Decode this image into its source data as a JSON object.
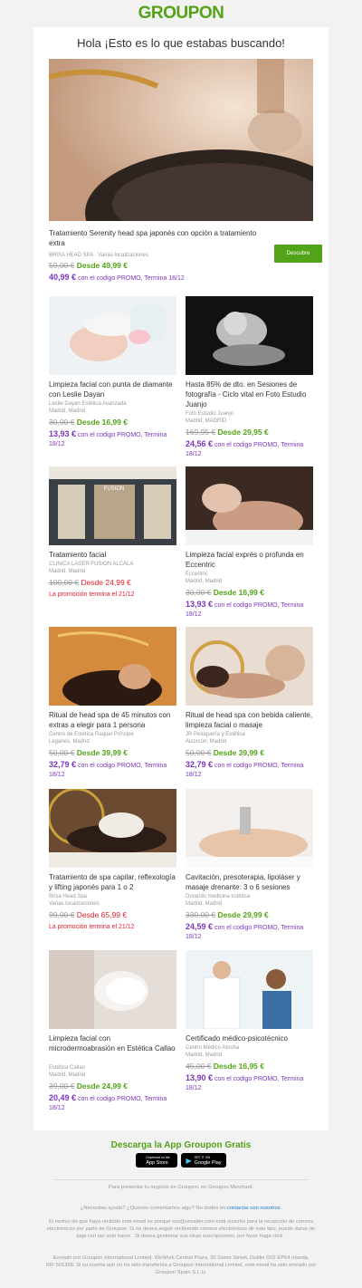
{
  "brand": {
    "logo": "GROUPON",
    "accent": "#53a318",
    "promo_color": "#7b35bf",
    "alert_color": "#e5202e"
  },
  "greeting": "Hola ¡Esto es lo que estabas buscando!",
  "featured": {
    "title": "Tratamiento Serenity head spa japonés con opción a tratamiento extra",
    "merchant": "BRISA HEAD SPA",
    "location": "Varias localizaciones",
    "old_price": "59,00 €",
    "new_price": "Desde 49,99 €",
    "promo_price": "40,99 €",
    "promo_text": "con el codigo PROMO, Termina 18/12",
    "button": "Descubre"
  },
  "deals": [
    {
      "title": "Limpieza facial con punta de diamante con Leslie Dayan",
      "merchant": "Leslie Dayan Estética Avanzada",
      "location": "Madrid, Madrid",
      "old_price": "30,00 €",
      "new_price": "Desde 16,99 €",
      "promo_price": "13,93 €",
      "promo_text": "con el codigo PROMO, Termina 18/12"
    },
    {
      "title": "Hasta 85% de dto. en Sesiones de fotografía - Ciclo vital en Foto Estudio Juanjo",
      "merchant": "Foto Estudio Juanjo",
      "location": "Madrid, MADRID",
      "old_price": "169,95 €",
      "new_price": "Desde 29,95 €",
      "promo_price": "24,56 €",
      "promo_text": "con el codigo PROMO, Termina 18/12"
    },
    {
      "title": "Tratamiento facial",
      "merchant": "CLINICA LASER FUSION ALCALA",
      "location": "Madrid, Madrid",
      "old_price": "100,00 €",
      "new_price": "Desde 24,99 €",
      "promo_end": "La promoción termina el 21/12"
    },
    {
      "title": "Limpieza facial exprés o profunda en Eccentric",
      "merchant": "Eccentric",
      "location": "Madrid, Madrid",
      "old_price": "30,00 €",
      "new_price": "Desde 16,99 €",
      "promo_price": "13,93 €",
      "promo_text": "con el codigo PROMO, Termina 18/12"
    },
    {
      "title": "Ritual de head spa de 45 minutos con extras a elegir para 1 persona",
      "merchant": "Centro de Estética Raquel Príncipe",
      "location": "Leganés, Madrid",
      "old_price": "50,00 €",
      "new_price": "Desde 39,99 €",
      "promo_price": "32,79 €",
      "promo_text": "con el codigo PROMO, Termina 18/12"
    },
    {
      "title": "Ritual de head spa con bebida caliente, limpieza facial o masaje",
      "merchant": "JR Peluquería y Estética",
      "location": "Alcorcón, Madrid",
      "old_price": "50,00 €",
      "new_price": "Desde 39,99 €",
      "promo_price": "32,79 €",
      "promo_text": "con el codigo PROMO, Termina 18/12"
    },
    {
      "title": "Tratamiento de spa capilar, reflexología y lifting japonés para 1 o 2",
      "merchant": "Brisa Head Spa",
      "location": "Varias localizaciones",
      "old_price": "99,00 €",
      "new_price": "Desde 65,99 €",
      "promo_end": "La promoción termina el 21/12"
    },
    {
      "title": "Cavitación, presoterapia, lipoláser y masaje drenante: 3 o 6 sesiones",
      "merchant": "Durando medicina estética",
      "location": "Madrid, Madrid",
      "old_price": "330,00 €",
      "new_price": "Desde 29,99 €",
      "promo_price": "24,59 €",
      "promo_text": "con el codigo PROMO, Termina 18/12"
    },
    {
      "title": "Limpieza facial con microdermoabrasión en Estética Callao",
      "merchant": "Estética Callao",
      "location": "Madrid, Madrid",
      "old_price": "39,00 €",
      "new_price": "Desde 24,99 €",
      "promo_price": "20,49 €",
      "promo_text": "con el codigo PROMO, Termina 18/12"
    },
    {
      "title": "Certificado médico-psicotécnico",
      "merchant": "Centro Médico Atocha",
      "location": "Madrid, Madrid",
      "old_price": "45,00 €",
      "new_price": "Desde 16,95 €",
      "promo_price": "13,90 €",
      "promo_text": "con el codigo PROMO, Termina 18/12"
    }
  ],
  "image_texts": {
    "fusion_sign": "FUSION"
  },
  "app": {
    "title": "Descarga la App Groupon Gratis",
    "appstore_small": "Download on the",
    "appstore": "App Store",
    "googleplay_small": "GET IT ON",
    "googleplay": "Google Play"
  },
  "footer": {
    "merchant_line": "Para presentar tu negocio en Groupon, en Groupon Merchant.",
    "help_text": "¿Necesitas ayuda? ¿Quieres comentarnos algo? No dudes en",
    "help_link": "contactar con nosotros.",
    "reason": "El motivo de que haya recibido este email es porque xxx@ureader.com está suscrito para la recepción de correos electrónicos por parte de Groupon. Si no desea seguir recibiendo correos electrónicos de este tipo, puede darse de baja con tan solo hacer . Si desea gestionar sus otras suscripciones, por favor haga click .",
    "sender": "Enviado por Groupon International Limited, WeWork Central Plaza, 36 Dame Street, Dublin D02 EP64 Irlanda, NIF:501358. Si su cuenta aún no ha sido transferida a Groupon International Limited, este email ha sido enviado por Groupon Spain S.L.U."
  }
}
